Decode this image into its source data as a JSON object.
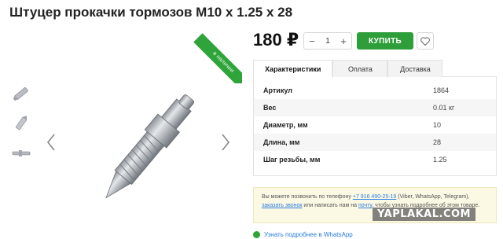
{
  "product": {
    "title": "Штуцер прокачки тормозов M10 x 1.25 x 28",
    "badge": "в наличии",
    "price": "180 ₽",
    "quantity": "1",
    "minus_label": "−",
    "plus_label": "+",
    "buy_label": "КУПИТЬ"
  },
  "tabs": [
    {
      "label": "Характеристики",
      "active": true
    },
    {
      "label": "Оплата",
      "active": false
    },
    {
      "label": "Доставка",
      "active": false
    }
  ],
  "specs": [
    {
      "name": "Артикул",
      "value": "1864"
    },
    {
      "name": "Вес",
      "value": "0.01 кг"
    },
    {
      "name": "Диаметр, мм",
      "value": "10"
    },
    {
      "name": "Длина, мм",
      "value": "28"
    },
    {
      "name": "Шаг резьбы, мм",
      "value": "1.25"
    }
  ],
  "info": {
    "text1": "Вы можете позвонить по телефону ",
    "phone": "+7 916 490-25-19",
    "text2": " (Viber, WhatsApp, Telegram),",
    "link_call": "заказать звонок",
    "text3": " или написать нам на ",
    "link_mail": "почту",
    "text4": ", чтобы узнать подробнее об этом товаре."
  },
  "whatsapp_link": "Узнать подробнее в WhatsApp",
  "watermark": "YAPLAKAL.COM",
  "colors": {
    "accent": "#2e9e3a",
    "link": "#2b7de1",
    "info_bg": "#fbf8e4"
  }
}
